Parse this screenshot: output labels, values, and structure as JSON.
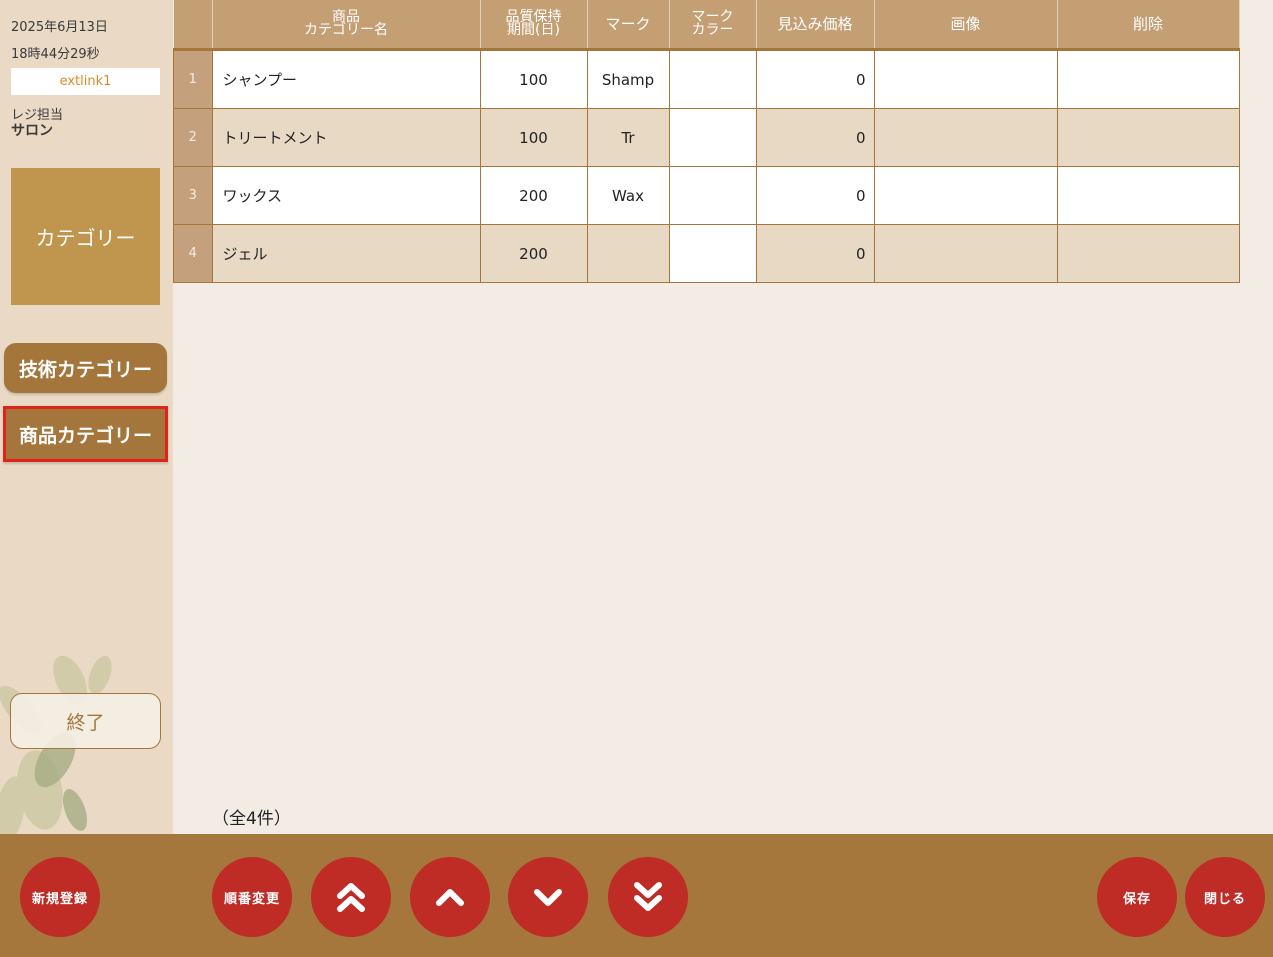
{
  "sidebar": {
    "date": "2025年6月13日",
    "time": "18時44分29秒",
    "link": "extlink1",
    "register_label": "レジ担当",
    "register_name": "サロン",
    "category_tile": "カテゴリー",
    "nav": {
      "tech_category": "技術カテゴリー",
      "product_category": "商品カテゴリー"
    },
    "exit": "終了"
  },
  "table": {
    "headers": {
      "name": [
        "商品",
        "カテゴリー名"
      ],
      "shelf_life": [
        "品質保持",
        "期間(日)"
      ],
      "mark": "マーク",
      "mark_color": [
        "マーク",
        "カラー"
      ],
      "expected_price": "見込み価格",
      "image": "画像",
      "delete": "削除"
    },
    "rows": [
      {
        "no": "1",
        "name": "シャンプー",
        "shelf_life": "100",
        "mark": "Shamp",
        "mark_color": "",
        "price": "0",
        "image": "",
        "delete": ""
      },
      {
        "no": "2",
        "name": "トリートメント",
        "shelf_life": "100",
        "mark": "Tr",
        "mark_color": "",
        "price": "0",
        "image": "",
        "delete": ""
      },
      {
        "no": "3",
        "name": "ワックス",
        "shelf_life": "200",
        "mark": "Wax",
        "mark_color": "",
        "price": "0",
        "image": "",
        "delete": ""
      },
      {
        "no": "4",
        "name": "ジェル",
        "shelf_life": "200",
        "mark": "",
        "mark_color": "",
        "price": "0",
        "image": "",
        "delete": ""
      }
    ]
  },
  "total_count": "（全4件）",
  "footer": {
    "new": "新規登録",
    "reorder": "順番変更",
    "move_top_icon": "double-chevron-up-icon",
    "move_up_icon": "chevron-up-icon",
    "move_down_icon": "chevron-down-icon",
    "move_bottom_icon": "double-chevron-down-icon",
    "save": "保存",
    "close": "閉じる"
  },
  "colors": {
    "sidebar_bg": "#ead9c5",
    "header_bg": "#c49f74",
    "footer_bg": "#a5773c",
    "accent_red": "#bf2b25",
    "nav_button": "#a4763c",
    "highlight_border": "#e2231a"
  }
}
